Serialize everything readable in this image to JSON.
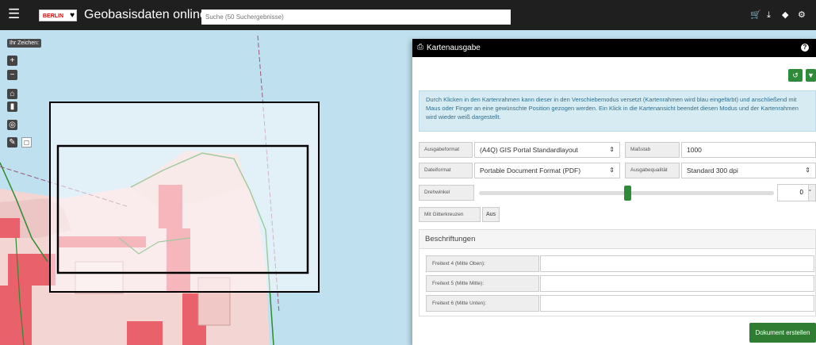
{
  "header": {
    "logo_text": "BERLIN",
    "title": "Geobasisdaten online",
    "search_placeholder": "Suche (50 Suchergebnisse)"
  },
  "draw_tools": {
    "label": "Ihr Zeichen:"
  },
  "panel": {
    "title": "Kartenausgabe",
    "info_text": "Durch Klicken in den Kartenrahmen kann dieser in den Verschiebemodus versetzt (Kartenrahmen wird blau eingefärbt) und anschließend mit Maus oder Finger an eine gewünschte Position gezogen werden. Ein Klick in die Kartenansicht beendet diesen Modus und der Kartenrahmen wird wieder weiß dargestellt.",
    "fields": {
      "format_label": "Ausgabeformat",
      "format_value": "(A4Q) GIS Portal Standardlayout",
      "scale_label": "Maßstab",
      "scale_value": "1000",
      "filetype_label": "Dateiformat",
      "filetype_value": "Portable Document Format (PDF)",
      "quality_label": "Ausgabequalität",
      "quality_value": "Standard 300 dpi",
      "rotation_label": "Drehwinkel",
      "rotation_value": "0",
      "rotation_unit": "°",
      "grid_label": "Mit Gitterkreuzen",
      "grid_value": "Aus"
    },
    "captions": {
      "heading": "Beschriftungen",
      "items": [
        {
          "label": "Freitext 4 (Mitte Oben):"
        },
        {
          "label": "Freitext 5 (Mitte Mitte):"
        },
        {
          "label": "Freitext 6 (Mitte Unten):"
        }
      ]
    },
    "create_button": "Dokument erstellen"
  },
  "colors": {
    "water": "#bfe0ee",
    "building": "#e8616b",
    "land": "#f3d6d4",
    "green": "#2e8b3a",
    "header": "#1f1f1f"
  }
}
